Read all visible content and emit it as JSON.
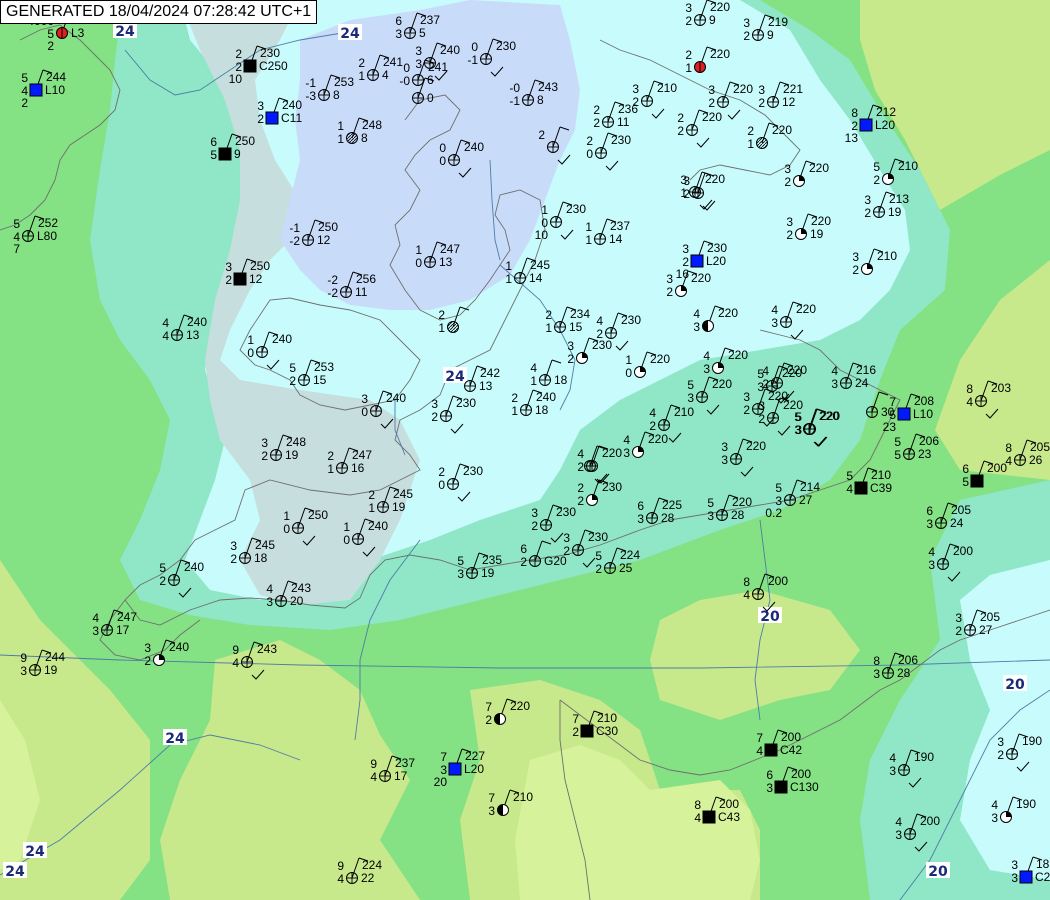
{
  "header": {
    "generated": "GENERATED 18/04/2024 07:28:42 UTC+1"
  },
  "colors": {
    "sea_green": "#84e184",
    "land_light_green": "#b8e89a",
    "land_yellow_green": "#c8e88c",
    "pale_yellow": "#d6f29a",
    "teal_band": "#8fe7c8",
    "pale_cyan": "#c8fcfc",
    "grey_blue": "#c6dede",
    "blue_cloud": "#c8dcfa",
    "fill_black": "#000000",
    "fill_blue": "#0019ff",
    "fill_red": "#e02020",
    "coast": "#6f6f6f",
    "border": "#4d7da6",
    "contour_label": "#1a2a78"
  },
  "contour_labels": [
    "24",
    "24",
    "24",
    "24",
    "24",
    "24",
    "20",
    "20",
    "20",
    "24"
  ],
  "stations": [
    {
      "id": "s01",
      "temp": "4000",
      "dew": "5",
      "pressure": "",
      "extra": "L3",
      "cover": "red",
      "extra2": "2"
    },
    {
      "id": "s02",
      "temp": "5",
      "dew": "4",
      "pressure": "244",
      "extra": "L10",
      "cover": "blue",
      "extra2": "2"
    },
    {
      "id": "s03",
      "temp": "5",
      "dew": "4",
      "pressure": "252",
      "extra": "L80",
      "cover": "clear",
      "extra2": "7"
    },
    {
      "id": "s04",
      "temp": "6",
      "dew": "3",
      "pressure": "237",
      "extra": "5",
      "cover": "clear",
      "extra2": ""
    },
    {
      "id": "s05",
      "temp": "2",
      "dew": "2",
      "pressure": "230",
      "extra": "C250",
      "cover": "black",
      "extra2": "10"
    },
    {
      "id": "s06",
      "temp": "3",
      "dew": "3",
      "pressure": "240",
      "extra": "",
      "cover": "clear",
      "extra2": ""
    },
    {
      "id": "s07",
      "temp": "0",
      "dew": "-1",
      "pressure": "230",
      "extra": "",
      "cover": "clear",
      "extra2": ""
    },
    {
      "id": "s08",
      "temp": "",
      "dew": "",
      "pressure": "",
      "extra": "0",
      "cover": "clear",
      "extra2": ""
    },
    {
      "id": "s09",
      "temp": "3",
      "dew": "2",
      "pressure": "240",
      "extra": "C11",
      "cover": "blue",
      "extra2": ""
    },
    {
      "id": "s10",
      "temp": "-1",
      "dew": "-3",
      "pressure": "253",
      "extra": "8",
      "cover": "clear",
      "extra2": ""
    },
    {
      "id": "s11",
      "temp": "2",
      "dew": "1",
      "pressure": "241",
      "extra": "4",
      "cover": "clear",
      "extra2": ""
    },
    {
      "id": "s12",
      "temp": "0",
      "dew": "-0",
      "pressure": "241",
      "extra": "6",
      "cover": "clear",
      "extra2": ""
    },
    {
      "id": "s13",
      "temp": "-0",
      "dew": "-1",
      "pressure": "243",
      "extra": "8",
      "cover": "clear",
      "extra2": ""
    },
    {
      "id": "s14",
      "temp": "1",
      "dew": "1",
      "pressure": "248",
      "extra": "8",
      "cover": "hatch",
      "extra2": ""
    },
    {
      "id": "s15",
      "temp": "6",
      "dew": "5",
      "pressure": "250",
      "extra": "9",
      "cover": "black",
      "extra2": ""
    },
    {
      "id": "s16",
      "temp": "0",
      "dew": "0",
      "pressure": "240",
      "extra": "",
      "cover": "clear",
      "extra2": ""
    },
    {
      "id": "s17",
      "temp": "-1",
      "dew": "-2",
      "pressure": "250",
      "extra": "12",
      "cover": "clear",
      "extra2": ""
    },
    {
      "id": "s18",
      "temp": "3",
      "dew": "2",
      "pressure": "250",
      "extra": "12",
      "cover": "black",
      "extra2": ""
    },
    {
      "id": "s19",
      "temp": "1",
      "dew": "0",
      "pressure": "247",
      "extra": "13",
      "cover": "clear",
      "extra2": ""
    },
    {
      "id": "s20",
      "temp": "-2",
      "dew": "-2",
      "pressure": "256",
      "extra": "11",
      "cover": "clear",
      "extra2": ""
    },
    {
      "id": "s21",
      "temp": "1",
      "dew": "1",
      "pressure": "245",
      "extra": "14",
      "cover": "clear",
      "extra2": ""
    },
    {
      "id": "s22",
      "temp": "1",
      "dew": "0",
      "pressure": "230",
      "extra": "",
      "cover": "clear",
      "extra2": "10"
    },
    {
      "id": "s23",
      "temp": "1",
      "dew": "1",
      "pressure": "237",
      "extra": "14",
      "cover": "clear",
      "extra2": ""
    },
    {
      "id": "s24",
      "temp": "4",
      "dew": "4",
      "pressure": "240",
      "extra": "13",
      "cover": "clear",
      "extra2": ""
    },
    {
      "id": "s25",
      "temp": "1",
      "dew": "0",
      "pressure": "240",
      "extra": "",
      "cover": "clear",
      "extra2": ""
    },
    {
      "id": "s26",
      "temp": "2",
      "dew": "1",
      "pressure": "",
      "extra": "",
      "cover": "hatch",
      "extra2": ""
    },
    {
      "id": "s27",
      "temp": "5",
      "dew": "2",
      "pressure": "253",
      "extra": "15",
      "cover": "clear",
      "extra2": ""
    },
    {
      "id": "s28",
      "temp": "2",
      "dew": "1",
      "pressure": "234",
      "extra": "15",
      "cover": "clear",
      "extra2": ""
    },
    {
      "id": "s29",
      "temp": "4",
      "dew": "2",
      "pressure": "230",
      "extra": "",
      "cover": "clear",
      "extra2": ""
    },
    {
      "id": "s30",
      "temp": "3",
      "dew": "2",
      "pressure": "230",
      "extra": "",
      "cover": "quarter",
      "extra2": ""
    },
    {
      "id": "s31",
      "temp": "1",
      "dew": "0",
      "pressure": "220",
      "extra": "",
      "cover": "quarter",
      "extra2": ""
    },
    {
      "id": "s32",
      "temp": "",
      "dew": "",
      "pressure": "242",
      "extra": "13",
      "cover": "clear",
      "extra2": ""
    },
    {
      "id": "s33",
      "temp": "4",
      "dew": "1",
      "pressure": "",
      "extra": "18",
      "cover": "clear",
      "extra2": ""
    },
    {
      "id": "s34",
      "temp": "2",
      "dew": "1",
      "pressure": "240",
      "extra": "18",
      "cover": "clear",
      "extra2": ""
    },
    {
      "id": "s35",
      "temp": "3",
      "dew": "0",
      "pressure": "240",
      "extra": "",
      "cover": "clear",
      "extra2": ""
    },
    {
      "id": "s36",
      "temp": "3",
      "dew": "2",
      "pressure": "230",
      "extra": "",
      "cover": "clear",
      "extra2": ""
    },
    {
      "id": "s37",
      "temp": "3",
      "dew": "2",
      "pressure": "248",
      "extra": "19",
      "cover": "clear",
      "extra2": ""
    },
    {
      "id": "s38",
      "temp": "2",
      "dew": "1",
      "pressure": "247",
      "extra": "16",
      "cover": "clear",
      "extra2": ""
    },
    {
      "id": "s39",
      "temp": "2",
      "dew": "1",
      "pressure": "245",
      "extra": "19",
      "cover": "clear",
      "extra2": ""
    },
    {
      "id": "s40",
      "temp": "2",
      "dew": "0",
      "pressure": "230",
      "extra": "",
      "cover": "clear",
      "extra2": ""
    },
    {
      "id": "s41",
      "temp": "3",
      "dew": "2",
      "pressure": "230",
      "extra": "",
      "cover": "clear",
      "extra2": ""
    },
    {
      "id": "s42",
      "temp": "1",
      "dew": "0",
      "pressure": "250",
      "extra": "",
      "cover": "clear",
      "extra2": ""
    },
    {
      "id": "s43",
      "temp": "1",
      "dew": "0",
      "pressure": "240",
      "extra": "",
      "cover": "clear",
      "extra2": ""
    },
    {
      "id": "s44",
      "temp": "3",
      "dew": "2",
      "pressure": "245",
      "extra": "18",
      "cover": "clear",
      "extra2": ""
    },
    {
      "id": "s45",
      "temp": "5",
      "dew": "2",
      "pressure": "240",
      "extra": "",
      "cover": "clear",
      "extra2": ""
    },
    {
      "id": "s46",
      "temp": "4",
      "dew": "3",
      "pressure": "243",
      "extra": "20",
      "cover": "clear",
      "extra2": ""
    },
    {
      "id": "s47",
      "temp": "4",
      "dew": "3",
      "pressure": "247",
      "extra": "17",
      "cover": "clear",
      "extra2": ""
    },
    {
      "id": "s48",
      "temp": "3",
      "dew": "2",
      "pressure": "240",
      "extra": "",
      "cover": "quarter",
      "extra2": ""
    },
    {
      "id": "s49",
      "temp": "9",
      "dew": "3",
      "pressure": "244",
      "extra": "19",
      "cover": "clear",
      "extra2": ""
    },
    {
      "id": "s50",
      "temp": "9",
      "dew": "4",
      "pressure": "243",
      "extra": "",
      "cover": "clear",
      "extra2": ""
    },
    {
      "id": "s51",
      "temp": "5",
      "dew": "3",
      "pressure": "235",
      "extra": "19",
      "cover": "clear",
      "extra2": ""
    },
    {
      "id": "s52",
      "temp": "6",
      "dew": "2",
      "pressure": "",
      "extra": "G20",
      "cover": "clear",
      "extra2": ""
    },
    {
      "id": "s53",
      "temp": "5",
      "dew": "2",
      "pressure": "224",
      "extra": "25",
      "cover": "clear",
      "extra2": ""
    },
    {
      "id": "s54",
      "temp": "3",
      "dew": "2",
      "pressure": "230",
      "extra": "",
      "cover": "clear",
      "extra2": ""
    },
    {
      "id": "s55",
      "temp": "",
      "dew": "",
      "pressure": "",
      "extra": "",
      "cover": "clear",
      "extra2": ""
    },
    {
      "id": "s56",
      "temp": "2",
      "dew": "2",
      "pressure": "230",
      "extra": "",
      "cover": "quarter",
      "extra2": ""
    },
    {
      "id": "s57",
      "temp": "6",
      "dew": "3",
      "pressure": "225",
      "extra": "28",
      "cover": "clear",
      "extra2": ""
    },
    {
      "id": "s58",
      "temp": "5",
      "dew": "3",
      "pressure": "220",
      "extra": "28",
      "cover": "clear",
      "extra2": ""
    },
    {
      "id": "s59",
      "temp": "5",
      "dew": "3",
      "pressure": "214",
      "extra": "27",
      "cover": "clear",
      "extra2": "0.2"
    },
    {
      "id": "s60",
      "temp": "5",
      "dew": "4",
      "pressure": "210",
      "extra": "C39",
      "cover": "black",
      "extra2": ""
    },
    {
      "id": "s61",
      "temp": "6",
      "dew": "5",
      "pressure": "200",
      "extra": "",
      "cover": "black",
      "extra2": ""
    },
    {
      "id": "s62",
      "temp": "8",
      "dew": "4",
      "pressure": "205",
      "extra": "26",
      "cover": "clear",
      "extra2": ""
    },
    {
      "id": "s63",
      "temp": "6",
      "dew": "3",
      "pressure": "205",
      "extra": "24",
      "cover": "clear",
      "extra2": ""
    },
    {
      "id": "s64",
      "temp": "4",
      "dew": "3",
      "pressure": "200",
      "extra": "",
      "cover": "clear",
      "extra2": ""
    },
    {
      "id": "s65",
      "temp": "3",
      "dew": "2",
      "pressure": "205",
      "extra": "27",
      "cover": "clear",
      "extra2": ""
    },
    {
      "id": "s66",
      "temp": "8",
      "dew": "3",
      "pressure": "206",
      "extra": "28",
      "cover": "clear",
      "extra2": ""
    },
    {
      "id": "s67",
      "temp": "8",
      "dew": "4",
      "pressure": "200",
      "extra": "",
      "cover": "clear",
      "extra2": ""
    },
    {
      "id": "s68",
      "temp": "3",
      "dew": "2",
      "pressure": "190",
      "extra": "",
      "cover": "clear",
      "extra2": ""
    },
    {
      "id": "s69",
      "temp": "4",
      "dew": "3",
      "pressure": "190",
      "extra": "",
      "cover": "clear",
      "extra2": ""
    },
    {
      "id": "s70",
      "temp": "4",
      "dew": "3",
      "pressure": "200",
      "extra": "",
      "cover": "clear",
      "extra2": ""
    },
    {
      "id": "s71",
      "temp": "4",
      "dew": "3",
      "pressure": "190",
      "extra": "",
      "cover": "quarter",
      "extra2": ""
    },
    {
      "id": "s72",
      "temp": "3",
      "dew": "3",
      "pressure": "18",
      "extra": "C2",
      "cover": "blue",
      "extra2": ""
    },
    {
      "id": "s73",
      "temp": "7",
      "dew": "2",
      "pressure": "220",
      "extra": "",
      "cover": "half",
      "extra2": ""
    },
    {
      "id": "s74",
      "temp": "7",
      "dew": "2",
      "pressure": "210",
      "extra": "C30",
      "cover": "black",
      "extra2": ""
    },
    {
      "id": "s75",
      "temp": "7",
      "dew": "4",
      "pressure": "200",
      "extra": "C42",
      "cover": "black",
      "extra2": ""
    },
    {
      "id": "s76",
      "temp": "6",
      "dew": "3",
      "pressure": "200",
      "extra": "C130",
      "cover": "black",
      "extra2": ""
    },
    {
      "id": "s77",
      "temp": "8",
      "dew": "4",
      "pressure": "200",
      "extra": "C43",
      "cover": "black",
      "extra2": ""
    },
    {
      "id": "s78",
      "temp": "7",
      "dew": "3",
      "pressure": "227",
      "extra": "L20",
      "cover": "blue",
      "extra2": "20"
    },
    {
      "id": "s79",
      "temp": "7",
      "dew": "3",
      "pressure": "210",
      "extra": "",
      "cover": "half",
      "extra2": ""
    },
    {
      "id": "s80",
      "temp": "9",
      "dew": "4",
      "pressure": "237",
      "extra": "17",
      "cover": "clear",
      "extra2": ""
    },
    {
      "id": "s81",
      "temp": "9",
      "dew": "4",
      "pressure": "224",
      "extra": "22",
      "cover": "clear",
      "extra2": ""
    },
    {
      "id": "s82",
      "temp": "3",
      "dew": "2",
      "pressure": "220",
      "extra": "9",
      "cover": "clear",
      "extra2": ""
    },
    {
      "id": "s83",
      "temp": "3",
      "dew": "2",
      "pressure": "219",
      "extra": "9",
      "cover": "clear",
      "extra2": ""
    },
    {
      "id": "s84",
      "temp": "2",
      "dew": "1",
      "pressure": "220",
      "extra": "",
      "cover": "red",
      "extra2": ""
    },
    {
      "id": "s85",
      "temp": "3",
      "dew": "2",
      "pressure": "210",
      "extra": "",
      "cover": "clear",
      "extra2": ""
    },
    {
      "id": "s86",
      "temp": "2",
      "dew": "2",
      "pressure": "236",
      "extra": "11",
      "cover": "clear",
      "extra2": ""
    },
    {
      "id": "s87",
      "temp": "3",
      "dew": "2",
      "pressure": "220",
      "extra": "",
      "cover": "clear",
      "extra2": ""
    },
    {
      "id": "s88",
      "temp": "2",
      "dew": "2",
      "pressure": "220",
      "extra": "",
      "cover": "clear",
      "extra2": ""
    },
    {
      "id": "s89",
      "temp": "3",
      "dew": "2",
      "pressure": "221",
      "extra": "12",
      "cover": "clear",
      "extra2": ""
    },
    {
      "id": "s90",
      "temp": "2",
      "dew": "1",
      "pressure": "220",
      "extra": "",
      "cover": "hatch",
      "extra2": ""
    },
    {
      "id": "s91",
      "temp": "8",
      "dew": "2",
      "pressure": "212",
      "extra": "L20",
      "cover": "blue",
      "extra2": "13"
    },
    {
      "id": "s92",
      "temp": "2",
      "dew": "0",
      "pressure": "230",
      "extra": "",
      "cover": "clear",
      "extra2": ""
    },
    {
      "id": "s93",
      "temp": "3",
      "dew": "1",
      "pressure": "220",
      "extra": "",
      "cover": "clear",
      "extra2": ""
    },
    {
      "id": "s94",
      "temp": "3",
      "dew": "2",
      "pressure": "220",
      "extra": "",
      "cover": "quarter",
      "extra2": ""
    },
    {
      "id": "s95",
      "temp": "5",
      "dew": "2",
      "pressure": "210",
      "extra": "",
      "cover": "quarter",
      "extra2": ""
    },
    {
      "id": "s96",
      "temp": "3",
      "dew": "2",
      "pressure": "213",
      "extra": "19",
      "cover": "clear",
      "extra2": ""
    },
    {
      "id": "s97",
      "temp": "3",
      "dew": "2",
      "pressure": "220",
      "extra": "19",
      "cover": "quarter",
      "extra2": ""
    },
    {
      "id": "s98",
      "temp": "3",
      "dew": "2",
      "pressure": "210",
      "extra": "",
      "cover": "quarter",
      "extra2": ""
    },
    {
      "id": "s99",
      "temp": "3",
      "dew": "2",
      "pressure": "230",
      "extra": "L20",
      "cover": "blue",
      "extra2": "16"
    },
    {
      "id": "s100",
      "temp": "3",
      "dew": "2",
      "pressure": "220",
      "extra": "",
      "cover": "quarter",
      "extra2": ""
    },
    {
      "id": "s101",
      "temp": "4",
      "dew": "3",
      "pressure": "220",
      "extra": "",
      "cover": "half",
      "extra2": ""
    },
    {
      "id": "s102",
      "temp": "4",
      "dew": "3",
      "pressure": "220",
      "extra": "",
      "cover": "clear",
      "extra2": ""
    },
    {
      "id": "s103",
      "temp": "4",
      "dew": "3",
      "pressure": "220",
      "extra": "",
      "cover": "quarter",
      "extra2": ""
    },
    {
      "id": "s104",
      "temp": "5",
      "dew": "3",
      "pressure": "220",
      "extra": "",
      "cover": "clear",
      "extra2": ""
    },
    {
      "id": "s105",
      "temp": "5",
      "dew": "3",
      "pressure": "220",
      "extra": "",
      "cover": "clear",
      "extra2": ""
    },
    {
      "id": "s106",
      "temp": "4",
      "dew": "2",
      "pressure": "210",
      "extra": "",
      "cover": "clear",
      "extra2": ""
    },
    {
      "id": "s107",
      "temp": "4",
      "dew": "3",
      "pressure": "216",
      "extra": "24",
      "cover": "clear",
      "extra2": ""
    },
    {
      "id": "s108",
      "temp": "7",
      "dew": "5",
      "pressure": "208",
      "extra": "L10",
      "cover": "blue",
      "extra2": "23"
    },
    {
      "id": "s109",
      "temp": "5",
      "dew": "5",
      "pressure": "206",
      "extra": "23",
      "cover": "clear",
      "extra2": ""
    },
    {
      "id": "s110",
      "temp": "8",
      "dew": "4",
      "pressure": "203",
      "extra": "",
      "cover": "clear",
      "extra2": ""
    },
    {
      "id": "s111",
      "temp": "3",
      "dew": "2",
      "pressure": "220",
      "extra": "",
      "cover": "clear",
      "extra2": ""
    },
    {
      "id": "s112",
      "temp": "5",
      "dew": "3",
      "pressure": "220",
      "extra": "",
      "cover": "clear",
      "extra2": ""
    },
    {
      "id": "s113",
      "temp": "4",
      "dew": "2",
      "pressure": "220",
      "extra": "",
      "cover": "clear",
      "extra2": ""
    },
    {
      "id": "s114",
      "temp": "4",
      "dew": "3",
      "pressure": "220",
      "extra": "",
      "cover": "quarter",
      "extra2": ""
    },
    {
      "id": "s115",
      "temp": "4",
      "dew": "2",
      "pressure": "220",
      "extra": "",
      "cover": "clear",
      "extra2": ""
    },
    {
      "id": "s116",
      "temp": "3",
      "dew": "2",
      "pressure": "220",
      "extra": "",
      "cover": "clear",
      "extra2": ""
    },
    {
      "id": "s117",
      "temp": "3",
      "dew": "3",
      "pressure": "220",
      "extra": "",
      "cover": "clear",
      "extra2": ""
    },
    {
      "id": "s118",
      "temp": "5",
      "dew": "3",
      "pressure": "220",
      "extra": "",
      "cover": "clear",
      "extra2": ""
    },
    {
      "id": "s119",
      "temp": "2",
      "dew": "",
      "pressure": "",
      "extra": "",
      "cover": "clear",
      "extra2": ""
    },
    {
      "id": "s120",
      "temp": "3",
      "dew": "2",
      "pressure": "",
      "extra": "",
      "cover": "clear",
      "extra2": ""
    },
    {
      "id": "s121",
      "temp": "",
      "dew": "",
      "pressure": "",
      "extra": "30",
      "cover": "clear",
      "extra2": ""
    }
  ]
}
